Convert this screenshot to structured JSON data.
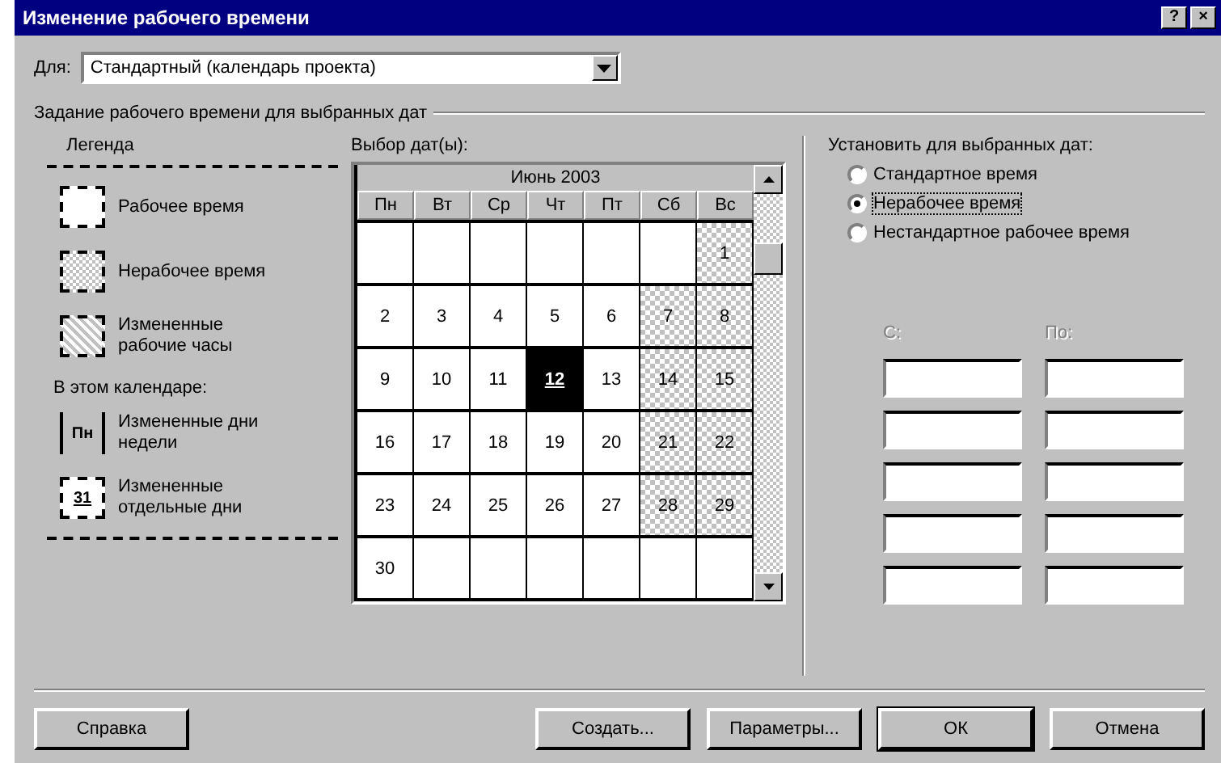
{
  "window": {
    "title": "Изменение рабочего времени",
    "help_button": "?",
    "close_button": "×"
  },
  "calendar_for": {
    "label": "Для:",
    "value": "Стандартный (календарь проекта)"
  },
  "group_title": "Задание рабочего времени для выбранных дат",
  "legend": {
    "title": "Легенда",
    "items": [
      {
        "kind": "working",
        "label": "Рабочее время"
      },
      {
        "kind": "nonworking",
        "label": "Нерабочее время"
      },
      {
        "kind": "modified",
        "label": "Измененные рабочие часы"
      }
    ],
    "subtitle": "В этом календаре:",
    "calendar_items": [
      {
        "kind": "weekday",
        "sample": "Пн",
        "label": "Измененные дни недели"
      },
      {
        "kind": "day",
        "sample": "31",
        "label": "Измененные отдельные дни"
      }
    ]
  },
  "date_picker": {
    "label": "Выбор дат(ы):",
    "month": "Июнь 2003",
    "weekdays": [
      "Пн",
      "Вт",
      "Ср",
      "Чт",
      "Пт",
      "Сб",
      "Вс"
    ],
    "weeks": [
      [
        {
          "kind": "blank",
          "selected": false
        },
        {
          "kind": "blank",
          "selected": false
        },
        {
          "kind": "blank",
          "selected": false
        },
        {
          "kind": "blank",
          "selected": false
        },
        {
          "kind": "blank",
          "selected": false
        },
        {
          "kind": "blank",
          "selected": false
        },
        {
          "day": "1",
          "kind": "weekend",
          "selected": false
        }
      ],
      [
        {
          "day": "2",
          "kind": "workday",
          "selected": false
        },
        {
          "day": "3",
          "kind": "workday",
          "selected": false
        },
        {
          "day": "4",
          "kind": "workday",
          "selected": false
        },
        {
          "day": "5",
          "kind": "workday",
          "selected": false
        },
        {
          "day": "6",
          "kind": "workday",
          "selected": false
        },
        {
          "day": "7",
          "kind": "weekend",
          "selected": false
        },
        {
          "day": "8",
          "kind": "weekend",
          "selected": false
        }
      ],
      [
        {
          "day": "9",
          "kind": "workday",
          "selected": false
        },
        {
          "day": "10",
          "kind": "workday",
          "selected": false
        },
        {
          "day": "11",
          "kind": "workday",
          "selected": false
        },
        {
          "day": "12",
          "kind": "workday",
          "selected": true
        },
        {
          "day": "13",
          "kind": "workday",
          "selected": false
        },
        {
          "day": "14",
          "kind": "weekend",
          "selected": false
        },
        {
          "day": "15",
          "kind": "weekend",
          "selected": false
        }
      ],
      [
        {
          "day": "16",
          "kind": "workday",
          "selected": false
        },
        {
          "day": "17",
          "kind": "workday",
          "selected": false
        },
        {
          "day": "18",
          "kind": "workday",
          "selected": false
        },
        {
          "day": "19",
          "kind": "workday",
          "selected": false
        },
        {
          "day": "20",
          "kind": "workday",
          "selected": false
        },
        {
          "day": "21",
          "kind": "weekend",
          "selected": false
        },
        {
          "day": "22",
          "kind": "weekend",
          "selected": false
        }
      ],
      [
        {
          "day": "23",
          "kind": "workday",
          "selected": false
        },
        {
          "day": "24",
          "kind": "workday",
          "selected": false
        },
        {
          "day": "25",
          "kind": "workday",
          "selected": false
        },
        {
          "day": "26",
          "kind": "workday",
          "selected": false
        },
        {
          "day": "27",
          "kind": "workday",
          "selected": false
        },
        {
          "day": "28",
          "kind": "weekend",
          "selected": false
        },
        {
          "day": "29",
          "kind": "weekend",
          "selected": false
        }
      ],
      [
        {
          "day": "30",
          "kind": "workday",
          "selected": false
        },
        {
          "kind": "blank",
          "selected": false
        },
        {
          "kind": "blank",
          "selected": false
        },
        {
          "kind": "blank",
          "selected": false
        },
        {
          "kind": "blank",
          "selected": false
        },
        {
          "kind": "blank",
          "selected": false
        },
        {
          "kind": "blank",
          "selected": false
        }
      ]
    ]
  },
  "settings": {
    "title": "Установить для выбранных дат:",
    "options": [
      {
        "label": "Стандартное время",
        "selected": false
      },
      {
        "label": "Нерабочее время",
        "selected": true
      },
      {
        "label": "Нестандартное рабочее время",
        "selected": false
      }
    ],
    "from_label": "С:",
    "to_label": "По:",
    "times_disabled": true
  },
  "buttons": {
    "left": [
      "Справка"
    ],
    "right": [
      {
        "label": "Создать...",
        "default": false
      },
      {
        "label": "Параметры...",
        "default": false
      },
      {
        "label": "ОК",
        "default": true
      },
      {
        "label": "Отмена",
        "default": false
      }
    ]
  }
}
